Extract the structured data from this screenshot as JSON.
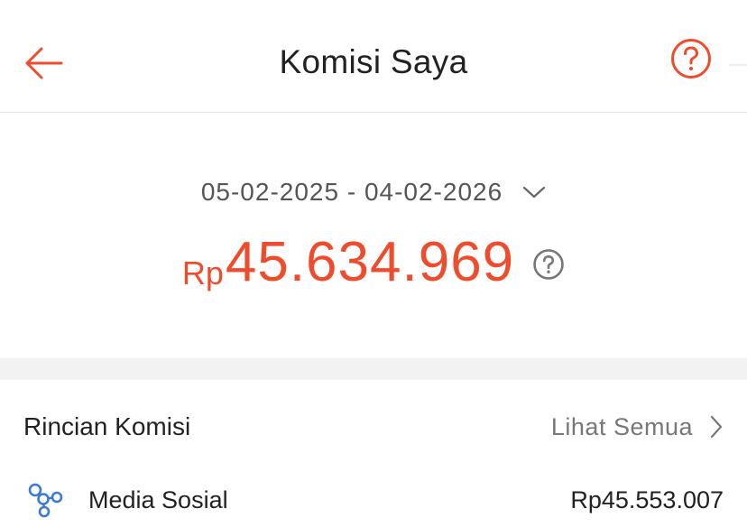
{
  "header": {
    "title": "Komisi Saya",
    "back_icon": "arrow-left-icon",
    "help_icon": "question-circle-icon"
  },
  "summary": {
    "date_range": "05-02-2025 - 04-02-2026",
    "currency": "Rp",
    "amount": "45.634.969",
    "dropdown_icon": "chevron-down-icon",
    "help_icon": "question-circle-icon"
  },
  "breakdown": {
    "title": "Rincian Komisi",
    "see_all": "Lihat Semua",
    "see_all_icon": "chevron-right-icon",
    "items": [
      {
        "label": "Media Sosial",
        "value": "Rp45.553.007",
        "icon": "social-network-icon"
      }
    ]
  },
  "colors": {
    "accent": "#ee4d2d",
    "icon_blue": "#3a7bd5",
    "text": "#222222",
    "muted": "#777777",
    "band": "#f2f2f2"
  }
}
